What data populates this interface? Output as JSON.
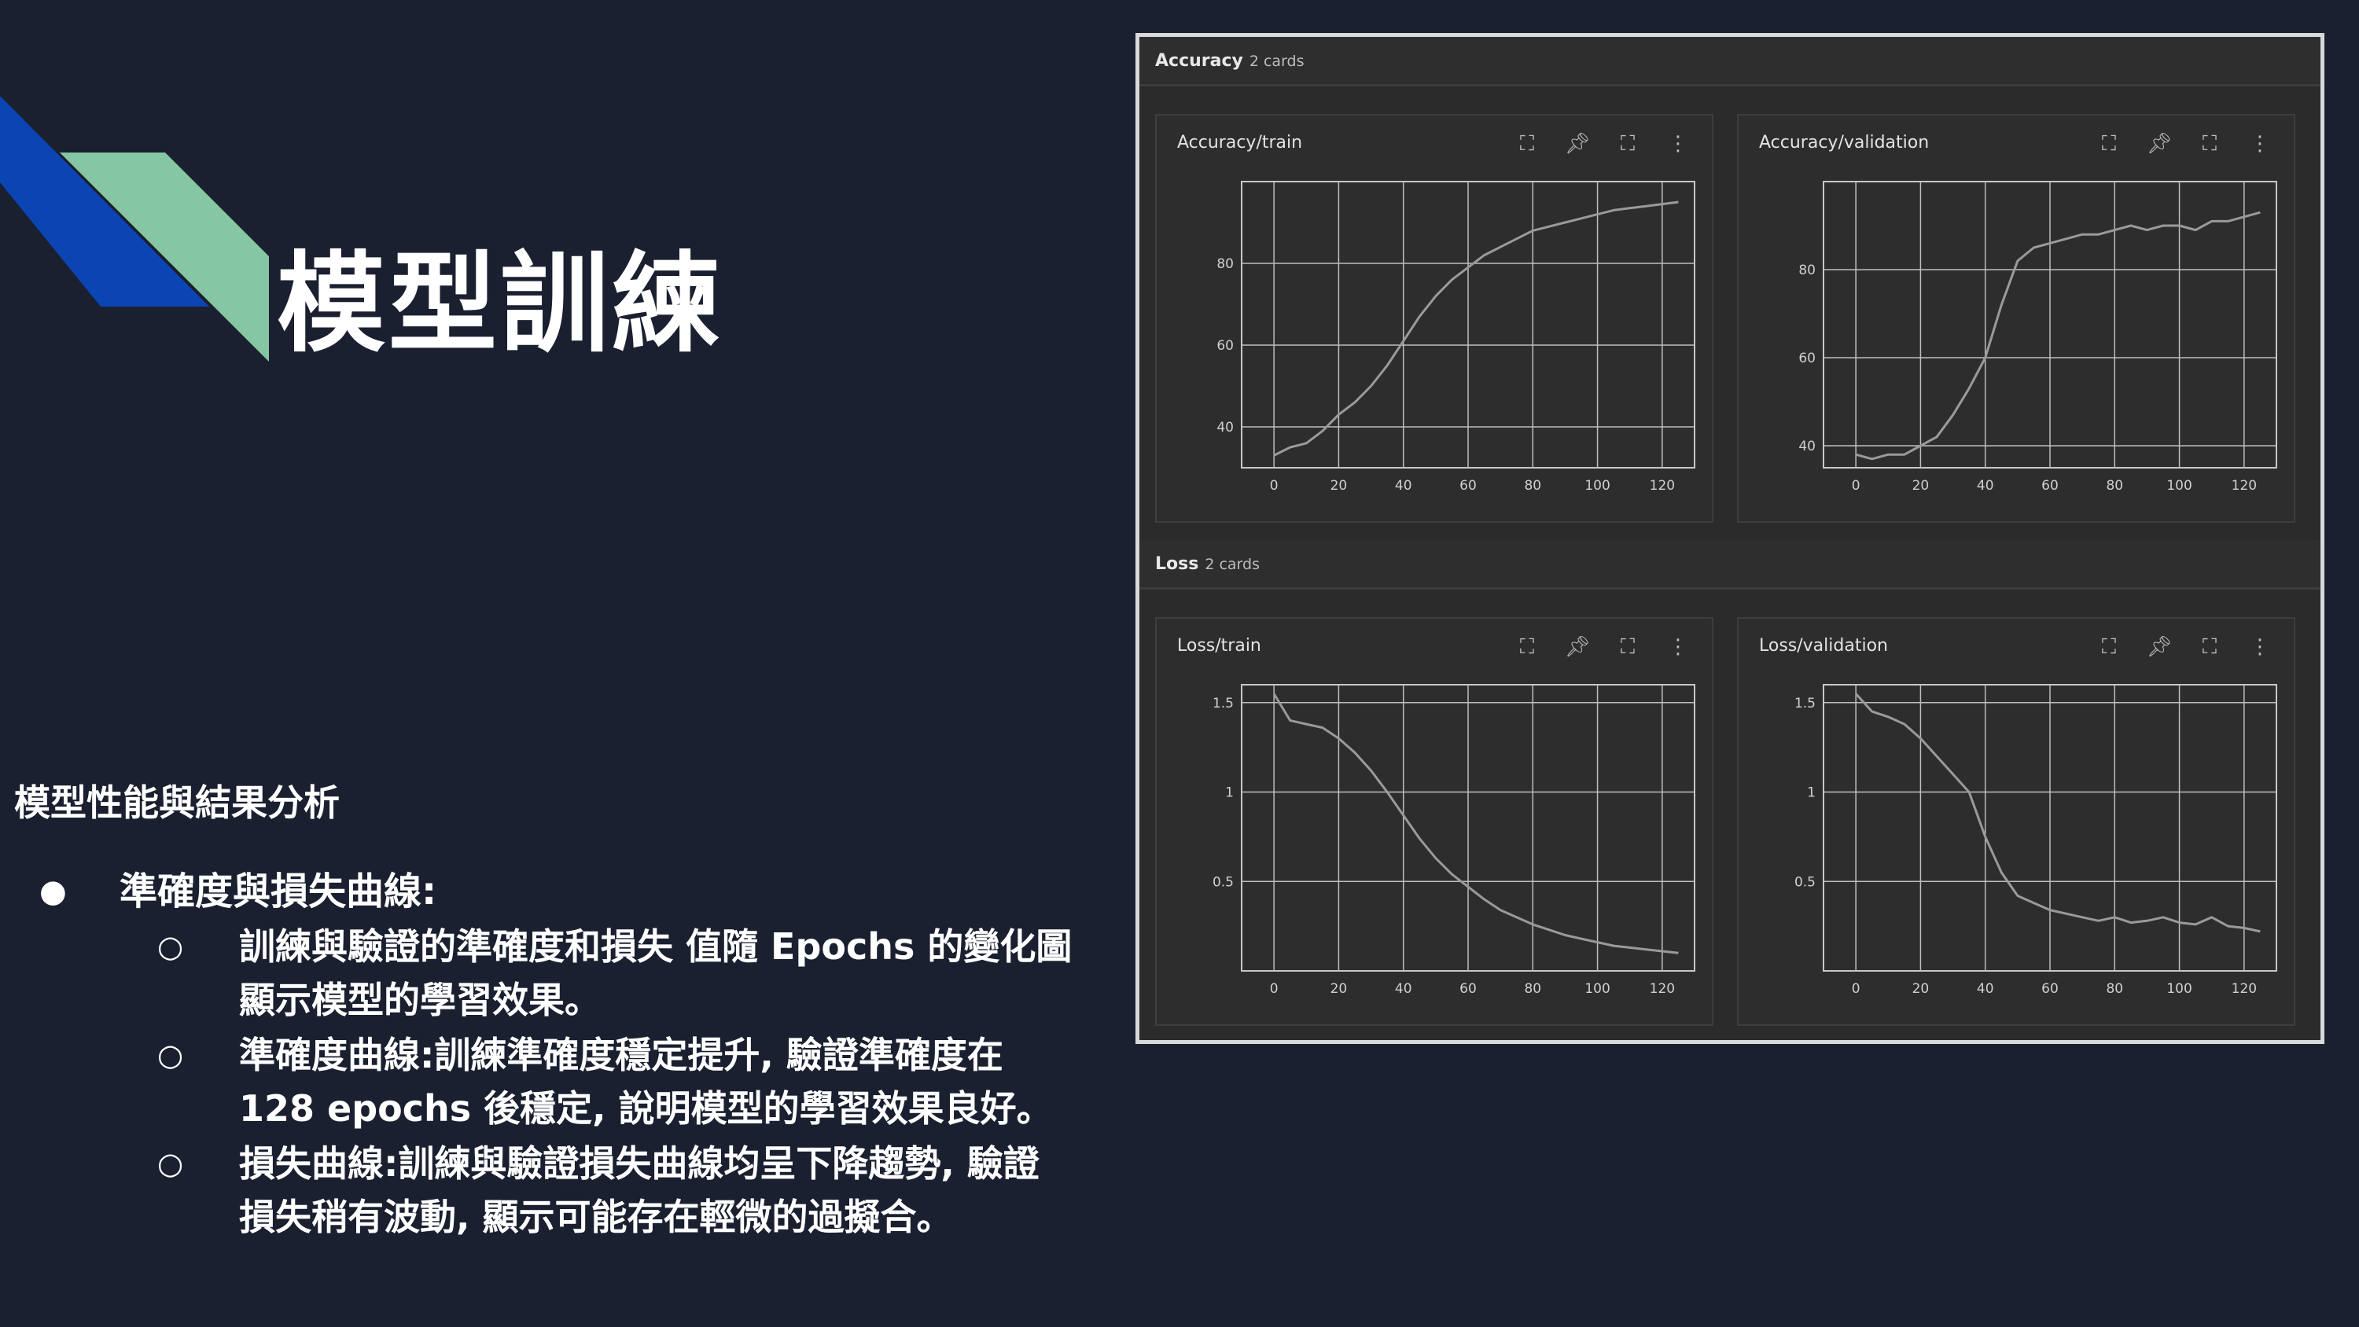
{
  "slide": {
    "title": "模型訓練",
    "section_heading": "模型性能與結果分析",
    "bullet_symbol": "●",
    "sub_bullet_symbol": "○",
    "bullet_main": "準確度與損失曲線:",
    "sub_bullets": [
      {
        "line1": "訓練與驗證的準確度和損失 值隨 Epochs 的變化圖",
        "line2": "顯示模型的學習效果。"
      },
      {
        "line1": "準確度曲線:訓練準確度穩定提升, 驗證準確度在",
        "line2": "128 epochs 後穩定, 說明模型的學習效果良好。"
      },
      {
        "line1": "損失曲線:訓練與驗證損失曲線均呈下降趨勢, 驗證",
        "line2": "損失稍有波動, 顯示可能存在輕微的過擬合。"
      }
    ],
    "colors": {
      "background": "#1a2030",
      "deco_blue": "#0b45b4",
      "deco_green": "#85c6a4"
    }
  },
  "dashboard": {
    "groups": [
      {
        "title": "Accuracy",
        "count": "2 cards"
      },
      {
        "title": "Loss",
        "count": "2 cards"
      }
    ],
    "icons": [
      "fit-domain-icon",
      "pin-icon",
      "fullscreen-icon",
      "more-vert-icon"
    ]
  },
  "chart_data": [
    {
      "type": "line",
      "title": "Accuracy/train",
      "xlim": [
        -10,
        130
      ],
      "ylim": [
        30,
        100
      ],
      "xticks": [
        0,
        20,
        40,
        60,
        80,
        100,
        120
      ],
      "yticks": [
        40,
        60,
        80
      ],
      "ytick_labels": [
        "40",
        "60",
        "80"
      ],
      "grid": true,
      "color": "#9a9a9a",
      "series": [
        {
          "x": [
            0,
            5,
            10,
            15,
            20,
            25,
            30,
            35,
            40,
            45,
            50,
            55,
            60,
            65,
            70,
            75,
            80,
            85,
            90,
            95,
            100,
            105,
            110,
            115,
            120,
            125
          ],
          "y": [
            33,
            35,
            36,
            39,
            43,
            46,
            50,
            55,
            61,
            67,
            72,
            76,
            79,
            82,
            84,
            86,
            88,
            89,
            90,
            91,
            92,
            93,
            93.5,
            94,
            94.5,
            95
          ]
        }
      ]
    },
    {
      "type": "line",
      "title": "Accuracy/validation",
      "xlim": [
        -10,
        130
      ],
      "ylim": [
        35,
        100
      ],
      "xticks": [
        0,
        20,
        40,
        60,
        80,
        100,
        120
      ],
      "yticks": [
        40,
        60,
        80
      ],
      "ytick_labels": [
        "40",
        "60",
        "80"
      ],
      "grid": true,
      "color": "#9a9a9a",
      "series": [
        {
          "x": [
            0,
            5,
            10,
            15,
            20,
            25,
            30,
            35,
            40,
            45,
            50,
            55,
            60,
            65,
            70,
            75,
            80,
            85,
            90,
            95,
            100,
            105,
            110,
            115,
            120,
            125
          ],
          "y": [
            38,
            37,
            38,
            38,
            40,
            42,
            47,
            53,
            60,
            72,
            82,
            85,
            86,
            87,
            88,
            88,
            89,
            90,
            89,
            90,
            90,
            89,
            91,
            91,
            92,
            93
          ]
        }
      ]
    },
    {
      "type": "line",
      "title": "Loss/train",
      "xlim": [
        -10,
        130
      ],
      "ylim": [
        0,
        1.6
      ],
      "xticks": [
        0,
        20,
        40,
        60,
        80,
        100,
        120
      ],
      "yticks": [
        0.5,
        1,
        1.5
      ],
      "ytick_labels": [
        "0.5",
        "1",
        "1.5"
      ],
      "grid": true,
      "color": "#9a9a9a",
      "series": [
        {
          "x": [
            0,
            5,
            10,
            15,
            20,
            25,
            30,
            35,
            40,
            45,
            50,
            55,
            60,
            65,
            70,
            75,
            80,
            85,
            90,
            95,
            100,
            105,
            110,
            115,
            120,
            125
          ],
          "y": [
            1.55,
            1.4,
            1.38,
            1.36,
            1.3,
            1.22,
            1.12,
            1.0,
            0.87,
            0.74,
            0.63,
            0.54,
            0.47,
            0.4,
            0.34,
            0.3,
            0.26,
            0.23,
            0.2,
            0.18,
            0.16,
            0.14,
            0.13,
            0.12,
            0.11,
            0.1
          ]
        }
      ]
    },
    {
      "type": "line",
      "title": "Loss/validation",
      "xlim": [
        -10,
        130
      ],
      "ylim": [
        0,
        1.6
      ],
      "xticks": [
        0,
        20,
        40,
        60,
        80,
        100,
        120
      ],
      "yticks": [
        0.5,
        1,
        1.5
      ],
      "ytick_labels": [
        "0.5",
        "1",
        "1.5"
      ],
      "grid": true,
      "color": "#9a9a9a",
      "series": [
        {
          "x": [
            0,
            5,
            10,
            15,
            20,
            25,
            30,
            35,
            40,
            45,
            50,
            55,
            60,
            65,
            70,
            75,
            80,
            85,
            90,
            95,
            100,
            105,
            110,
            115,
            120,
            125
          ],
          "y": [
            1.55,
            1.45,
            1.42,
            1.38,
            1.3,
            1.2,
            1.1,
            1.0,
            0.75,
            0.55,
            0.42,
            0.38,
            0.34,
            0.32,
            0.3,
            0.28,
            0.3,
            0.27,
            0.28,
            0.3,
            0.27,
            0.26,
            0.3,
            0.25,
            0.24,
            0.22
          ]
        }
      ]
    }
  ]
}
